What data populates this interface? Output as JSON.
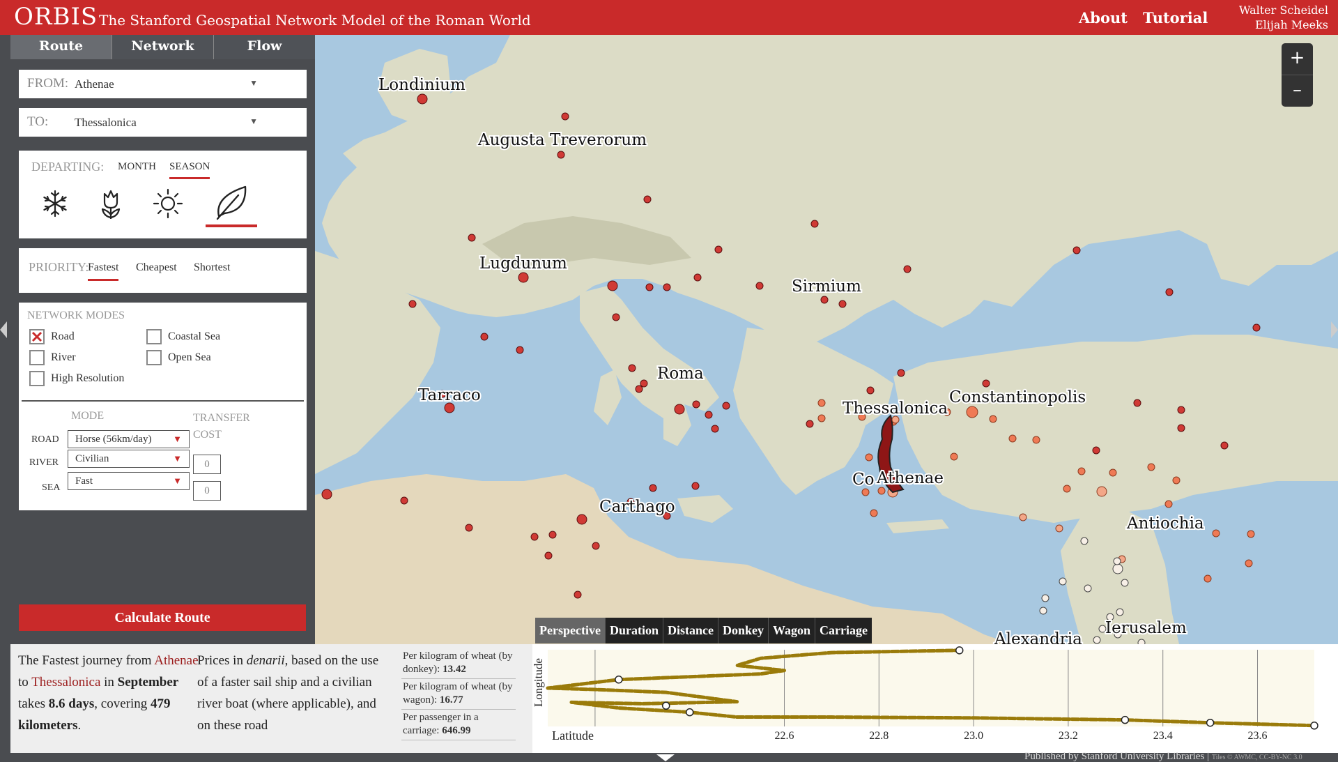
{
  "header": {
    "logo": "ORBIS",
    "subtitle": "The Stanford Geospatial Network Model of the Roman World",
    "nav": {
      "about": "About",
      "tutorial": "Tutorial"
    },
    "authors": [
      "Walter Scheidel",
      "Elijah Meeks"
    ],
    "colors": {
      "brand": "#c92a2a"
    }
  },
  "sidebar": {
    "tabs": [
      {
        "label": "Route",
        "active": true
      },
      {
        "label": "Network",
        "active": false
      },
      {
        "label": "Flow",
        "active": false
      }
    ],
    "from": {
      "label": "FROM:",
      "value": "Athenae"
    },
    "to": {
      "label": "TO:",
      "value": "Thessalonica"
    },
    "departing": {
      "label": "DEPARTING:",
      "month_label": "MONTH",
      "season_label": "SEASON",
      "selected_mode": "SEASON",
      "seasons": [
        {
          "icon": "snowflake-icon",
          "selected": false
        },
        {
          "icon": "tulip-icon",
          "selected": false
        },
        {
          "icon": "sun-icon",
          "selected": false
        },
        {
          "icon": "leaf-icon",
          "selected": true
        }
      ]
    },
    "priority": {
      "label": "PRIORITY:",
      "options": [
        "Fastest",
        "Cheapest",
        "Shortest"
      ],
      "selected": "Fastest"
    },
    "network_modes": {
      "title": "NETWORK MODES",
      "options": {
        "road": {
          "label": "Road",
          "checked": true
        },
        "river": {
          "label": "River",
          "checked": false
        },
        "high_res": {
          "label": "High Resolution",
          "checked": false
        },
        "coastal": {
          "label": "Coastal Sea",
          "checked": false
        },
        "open_sea": {
          "label": "Open Sea",
          "checked": false
        }
      },
      "mode_header": "MODE",
      "transfer_header": [
        "TRANSFER",
        "COST"
      ],
      "rows": [
        {
          "label": "ROAD",
          "value": "Horse (56km/day)"
        },
        {
          "label": "RIVER",
          "value": "Civilian",
          "transfer": "0"
        },
        {
          "label": "SEA",
          "value": "Fast",
          "transfer": "0"
        }
      ]
    },
    "calculate_label": "Calculate Route"
  },
  "map": {
    "zoom_in": "+",
    "zoom_out": "–",
    "labels": [
      "Londinium",
      "Augusta Treverorum",
      "Lugdunum",
      "Sirmium",
      "Roma",
      "Tarraco",
      "Thessalonica",
      "Constantinopolis",
      "Athenae",
      "Carthago",
      "Antiochia",
      "Ierusalem",
      "Alexandria"
    ],
    "partial_label": "Co",
    "colors": {
      "sea": "#a8c8e0",
      "land": "#dcdcc6",
      "site": "#d03a35",
      "route": "#8e1616"
    }
  },
  "chart_tabs": [
    "Perspective",
    "Duration",
    "Distance",
    "Donkey",
    "Wagon",
    "Carriage"
  ],
  "chart_tab_active": "Perspective",
  "summary": {
    "pre": "The Fastest journey from ",
    "from": "Athenae",
    "to_word": " to ",
    "to": "Thessalonica",
    "in_word": " in ",
    "month": "September",
    "takes": " takes ",
    "days": "8.6 days",
    "covering": ", covering ",
    "km": "479 kilometers",
    "end": "."
  },
  "prices": {
    "pre": "Prices in ",
    "currency": "denarii",
    "post": ", based on the use of a faster sail ship and a civilian river boat (where applicable), and on these road"
  },
  "costs": [
    {
      "label": "Per kilogram of wheat (by donkey): ",
      "value": "13.42"
    },
    {
      "label": "Per kilogram of wheat (by wagon): ",
      "value": "16.77"
    },
    {
      "label": "Per passenger in a carriage: ",
      "value": "646.99"
    }
  ],
  "chart_data": {
    "type": "line",
    "xlabel": "Latitude",
    "ylabel": "Longitude",
    "xticks": [
      "22.6",
      "22.8",
      "23.0",
      "23.2",
      "23.4",
      "23.6"
    ],
    "xlim": [
      22.1,
      23.72
    ],
    "ylim": [
      37.95,
      40.65
    ],
    "grid": true,
    "series": [
      {
        "x": [
          23.72,
          23.5,
          23.32,
          23.0,
          22.7,
          22.5,
          22.4,
          22.25,
          22.15,
          22.3,
          22.5,
          22.35,
          22.2,
          22.1,
          22.25,
          22.4,
          22.55,
          22.6,
          22.5,
          22.55,
          22.7,
          22.97
        ],
        "y": [
          37.98,
          38.08,
          38.18,
          38.25,
          38.28,
          38.28,
          38.45,
          38.6,
          38.8,
          38.75,
          38.82,
          39.15,
          39.25,
          39.3,
          39.6,
          39.7,
          39.8,
          39.92,
          40.1,
          40.35,
          40.55,
          40.63
        ]
      }
    ],
    "markers": [
      {
        "x": 23.72,
        "y": 37.98
      },
      {
        "x": 23.5,
        "y": 38.08
      },
      {
        "x": 23.32,
        "y": 38.18
      },
      {
        "x": 22.4,
        "y": 38.45
      },
      {
        "x": 22.35,
        "y": 38.68
      },
      {
        "x": 22.25,
        "y": 39.6
      },
      {
        "x": 22.97,
        "y": 40.63
      }
    ],
    "colors": {
      "line": "#9a7b0a",
      "bg": "#fbf9ec"
    }
  },
  "footer": {
    "text": "Published by Stanford University Libraries | ",
    "small": "Tiles © AWMC, CC-BY-NC 3.0"
  }
}
